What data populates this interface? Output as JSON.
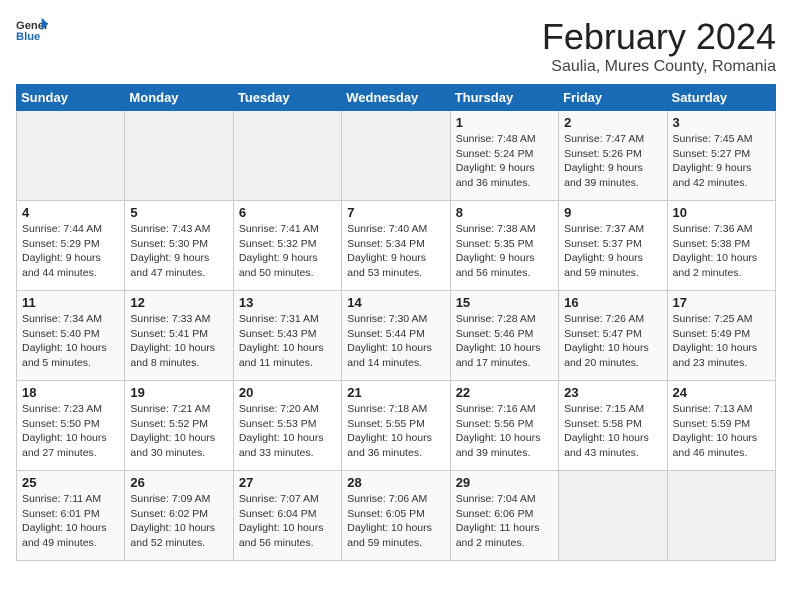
{
  "header": {
    "logo_general": "General",
    "logo_blue": "Blue",
    "month": "February 2024",
    "location": "Saulia, Mures County, Romania"
  },
  "days_of_week": [
    "Sunday",
    "Monday",
    "Tuesday",
    "Wednesday",
    "Thursday",
    "Friday",
    "Saturday"
  ],
  "weeks": [
    [
      {
        "day": "",
        "info": ""
      },
      {
        "day": "",
        "info": ""
      },
      {
        "day": "",
        "info": ""
      },
      {
        "day": "",
        "info": ""
      },
      {
        "day": "1",
        "info": "Sunrise: 7:48 AM\nSunset: 5:24 PM\nDaylight: 9 hours\nand 36 minutes."
      },
      {
        "day": "2",
        "info": "Sunrise: 7:47 AM\nSunset: 5:26 PM\nDaylight: 9 hours\nand 39 minutes."
      },
      {
        "day": "3",
        "info": "Sunrise: 7:45 AM\nSunset: 5:27 PM\nDaylight: 9 hours\nand 42 minutes."
      }
    ],
    [
      {
        "day": "4",
        "info": "Sunrise: 7:44 AM\nSunset: 5:29 PM\nDaylight: 9 hours\nand 44 minutes."
      },
      {
        "day": "5",
        "info": "Sunrise: 7:43 AM\nSunset: 5:30 PM\nDaylight: 9 hours\nand 47 minutes."
      },
      {
        "day": "6",
        "info": "Sunrise: 7:41 AM\nSunset: 5:32 PM\nDaylight: 9 hours\nand 50 minutes."
      },
      {
        "day": "7",
        "info": "Sunrise: 7:40 AM\nSunset: 5:34 PM\nDaylight: 9 hours\nand 53 minutes."
      },
      {
        "day": "8",
        "info": "Sunrise: 7:38 AM\nSunset: 5:35 PM\nDaylight: 9 hours\nand 56 minutes."
      },
      {
        "day": "9",
        "info": "Sunrise: 7:37 AM\nSunset: 5:37 PM\nDaylight: 9 hours\nand 59 minutes."
      },
      {
        "day": "10",
        "info": "Sunrise: 7:36 AM\nSunset: 5:38 PM\nDaylight: 10 hours\nand 2 minutes."
      }
    ],
    [
      {
        "day": "11",
        "info": "Sunrise: 7:34 AM\nSunset: 5:40 PM\nDaylight: 10 hours\nand 5 minutes."
      },
      {
        "day": "12",
        "info": "Sunrise: 7:33 AM\nSunset: 5:41 PM\nDaylight: 10 hours\nand 8 minutes."
      },
      {
        "day": "13",
        "info": "Sunrise: 7:31 AM\nSunset: 5:43 PM\nDaylight: 10 hours\nand 11 minutes."
      },
      {
        "day": "14",
        "info": "Sunrise: 7:30 AM\nSunset: 5:44 PM\nDaylight: 10 hours\nand 14 minutes."
      },
      {
        "day": "15",
        "info": "Sunrise: 7:28 AM\nSunset: 5:46 PM\nDaylight: 10 hours\nand 17 minutes."
      },
      {
        "day": "16",
        "info": "Sunrise: 7:26 AM\nSunset: 5:47 PM\nDaylight: 10 hours\nand 20 minutes."
      },
      {
        "day": "17",
        "info": "Sunrise: 7:25 AM\nSunset: 5:49 PM\nDaylight: 10 hours\nand 23 minutes."
      }
    ],
    [
      {
        "day": "18",
        "info": "Sunrise: 7:23 AM\nSunset: 5:50 PM\nDaylight: 10 hours\nand 27 minutes."
      },
      {
        "day": "19",
        "info": "Sunrise: 7:21 AM\nSunset: 5:52 PM\nDaylight: 10 hours\nand 30 minutes."
      },
      {
        "day": "20",
        "info": "Sunrise: 7:20 AM\nSunset: 5:53 PM\nDaylight: 10 hours\nand 33 minutes."
      },
      {
        "day": "21",
        "info": "Sunrise: 7:18 AM\nSunset: 5:55 PM\nDaylight: 10 hours\nand 36 minutes."
      },
      {
        "day": "22",
        "info": "Sunrise: 7:16 AM\nSunset: 5:56 PM\nDaylight: 10 hours\nand 39 minutes."
      },
      {
        "day": "23",
        "info": "Sunrise: 7:15 AM\nSunset: 5:58 PM\nDaylight: 10 hours\nand 43 minutes."
      },
      {
        "day": "24",
        "info": "Sunrise: 7:13 AM\nSunset: 5:59 PM\nDaylight: 10 hours\nand 46 minutes."
      }
    ],
    [
      {
        "day": "25",
        "info": "Sunrise: 7:11 AM\nSunset: 6:01 PM\nDaylight: 10 hours\nand 49 minutes."
      },
      {
        "day": "26",
        "info": "Sunrise: 7:09 AM\nSunset: 6:02 PM\nDaylight: 10 hours\nand 52 minutes."
      },
      {
        "day": "27",
        "info": "Sunrise: 7:07 AM\nSunset: 6:04 PM\nDaylight: 10 hours\nand 56 minutes."
      },
      {
        "day": "28",
        "info": "Sunrise: 7:06 AM\nSunset: 6:05 PM\nDaylight: 10 hours\nand 59 minutes."
      },
      {
        "day": "29",
        "info": "Sunrise: 7:04 AM\nSunset: 6:06 PM\nDaylight: 11 hours\nand 2 minutes."
      },
      {
        "day": "",
        "info": ""
      },
      {
        "day": "",
        "info": ""
      }
    ]
  ]
}
